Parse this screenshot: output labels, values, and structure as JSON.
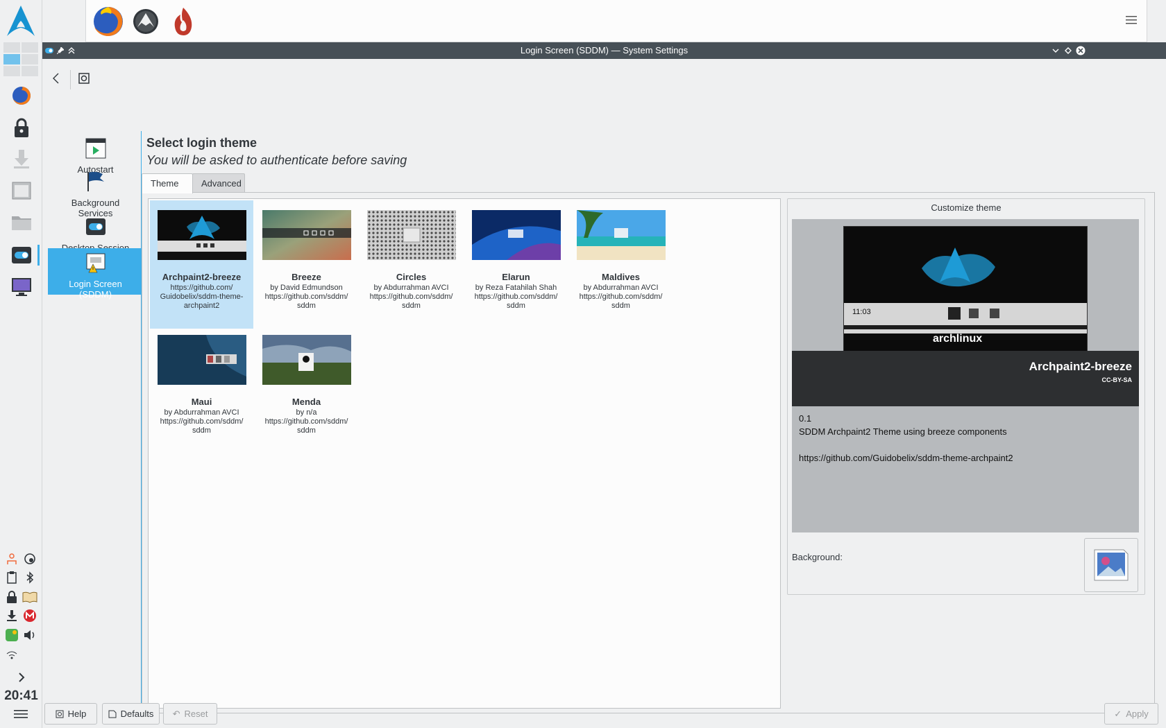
{
  "window": {
    "title": "Login Screen (SDDM)  — System Settings"
  },
  "sidebar": {
    "items": [
      {
        "label": "Autostart"
      },
      {
        "label": "Background Services"
      },
      {
        "label": "Desktop Session"
      },
      {
        "label": "Login Screen (SDDM)"
      }
    ]
  },
  "page": {
    "heading": "Select login theme",
    "subheading": "You will be asked to authenticate before saving"
  },
  "tabs": [
    {
      "label": "Theme"
    },
    {
      "label": "Advanced"
    }
  ],
  "themes": [
    {
      "name": "Archpaint2-breeze",
      "author": "https://github.com/ Guidobelix/sddm-theme-archpaint2"
    },
    {
      "name": "Breeze",
      "author": "by David Edmundson https://github.com/sddm/ sddm"
    },
    {
      "name": "Circles",
      "author": "by Abdurrahman AVCI https://github.com/sddm/ sddm"
    },
    {
      "name": "Elarun",
      "author": "by Reza Fatahilah Shah https://github.com/sddm/ sddm"
    },
    {
      "name": "Maldives",
      "author": "by Abdurrahman AVCI https://github.com/sddm/ sddm"
    },
    {
      "name": "Maui",
      "author": "by Abdurrahman AVCI https://github.com/sddm/ sddm"
    },
    {
      "name": "Menda",
      "author": "by n/a https://github.com/sddm/ sddm"
    }
  ],
  "customize": {
    "title": "Customize theme",
    "preview_clock": "11:03",
    "preview_logo": "archlinux",
    "theme_name": "Archpaint2-breeze",
    "license": "CC-BY-SA",
    "version": "0.1",
    "description": "SDDM Archpaint2 Theme using breeze components",
    "url": "https://github.com/Guidobelix/sddm-theme-archpaint2",
    "background_label": "Background:"
  },
  "buttons": {
    "help": "Help",
    "defaults": "Defaults",
    "reset": "Reset",
    "apply": "Apply"
  },
  "panel": {
    "clock": "20:41"
  },
  "colors": {
    "accent": "#3daee9",
    "titlebar": "#475057",
    "selected_theme_bg": "#c2e2f7"
  },
  "icons": [
    "arch-logo-icon",
    "firefox-icon",
    "lock-icon",
    "download-icon",
    "window-icon",
    "folder-icon",
    "toggle-icon",
    "display-icon",
    "menu-icon",
    "back-icon"
  ]
}
